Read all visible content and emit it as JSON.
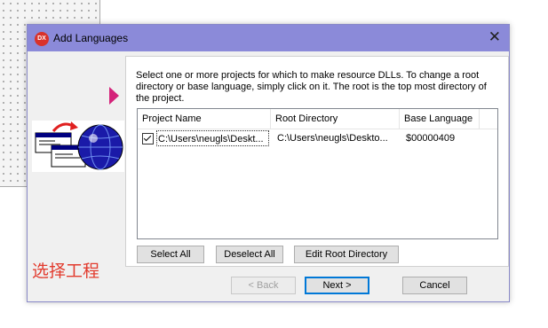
{
  "dialog": {
    "title": "Add Languages",
    "app_icon_text": "DX",
    "close_glyph": "✕"
  },
  "instructions": "Select one or more projects for which to make resource DLLs. To change a root directory or base language, simply click on it. The root is the top most directory of the project.",
  "table": {
    "columns": [
      "Project Name",
      "Root Directory",
      "Base Language"
    ],
    "rows": [
      {
        "checked": true,
        "project_name": "C:\\Users\\neugls\\Deskt...",
        "root_directory": "C:\\Users\\neugls\\Deskto...",
        "base_language": "$00000409"
      }
    ]
  },
  "buttons": {
    "select_all": "Select All",
    "deselect_all": "Deselect All",
    "edit_root_directory": "Edit Root Directory",
    "back": "< Back",
    "next": "Next >",
    "cancel": "Cancel"
  },
  "annotation": "选择工程",
  "colors": {
    "titlebar": "#8b8ad9",
    "arrow_marker": "#d4237a",
    "annotation": "#e23b2e",
    "app_icon": "#d9322b"
  },
  "icons": [
    "app-logo-icon",
    "close-icon",
    "wizard-arrow-icon",
    "globe-icon",
    "checkbox-checked-icon"
  ]
}
